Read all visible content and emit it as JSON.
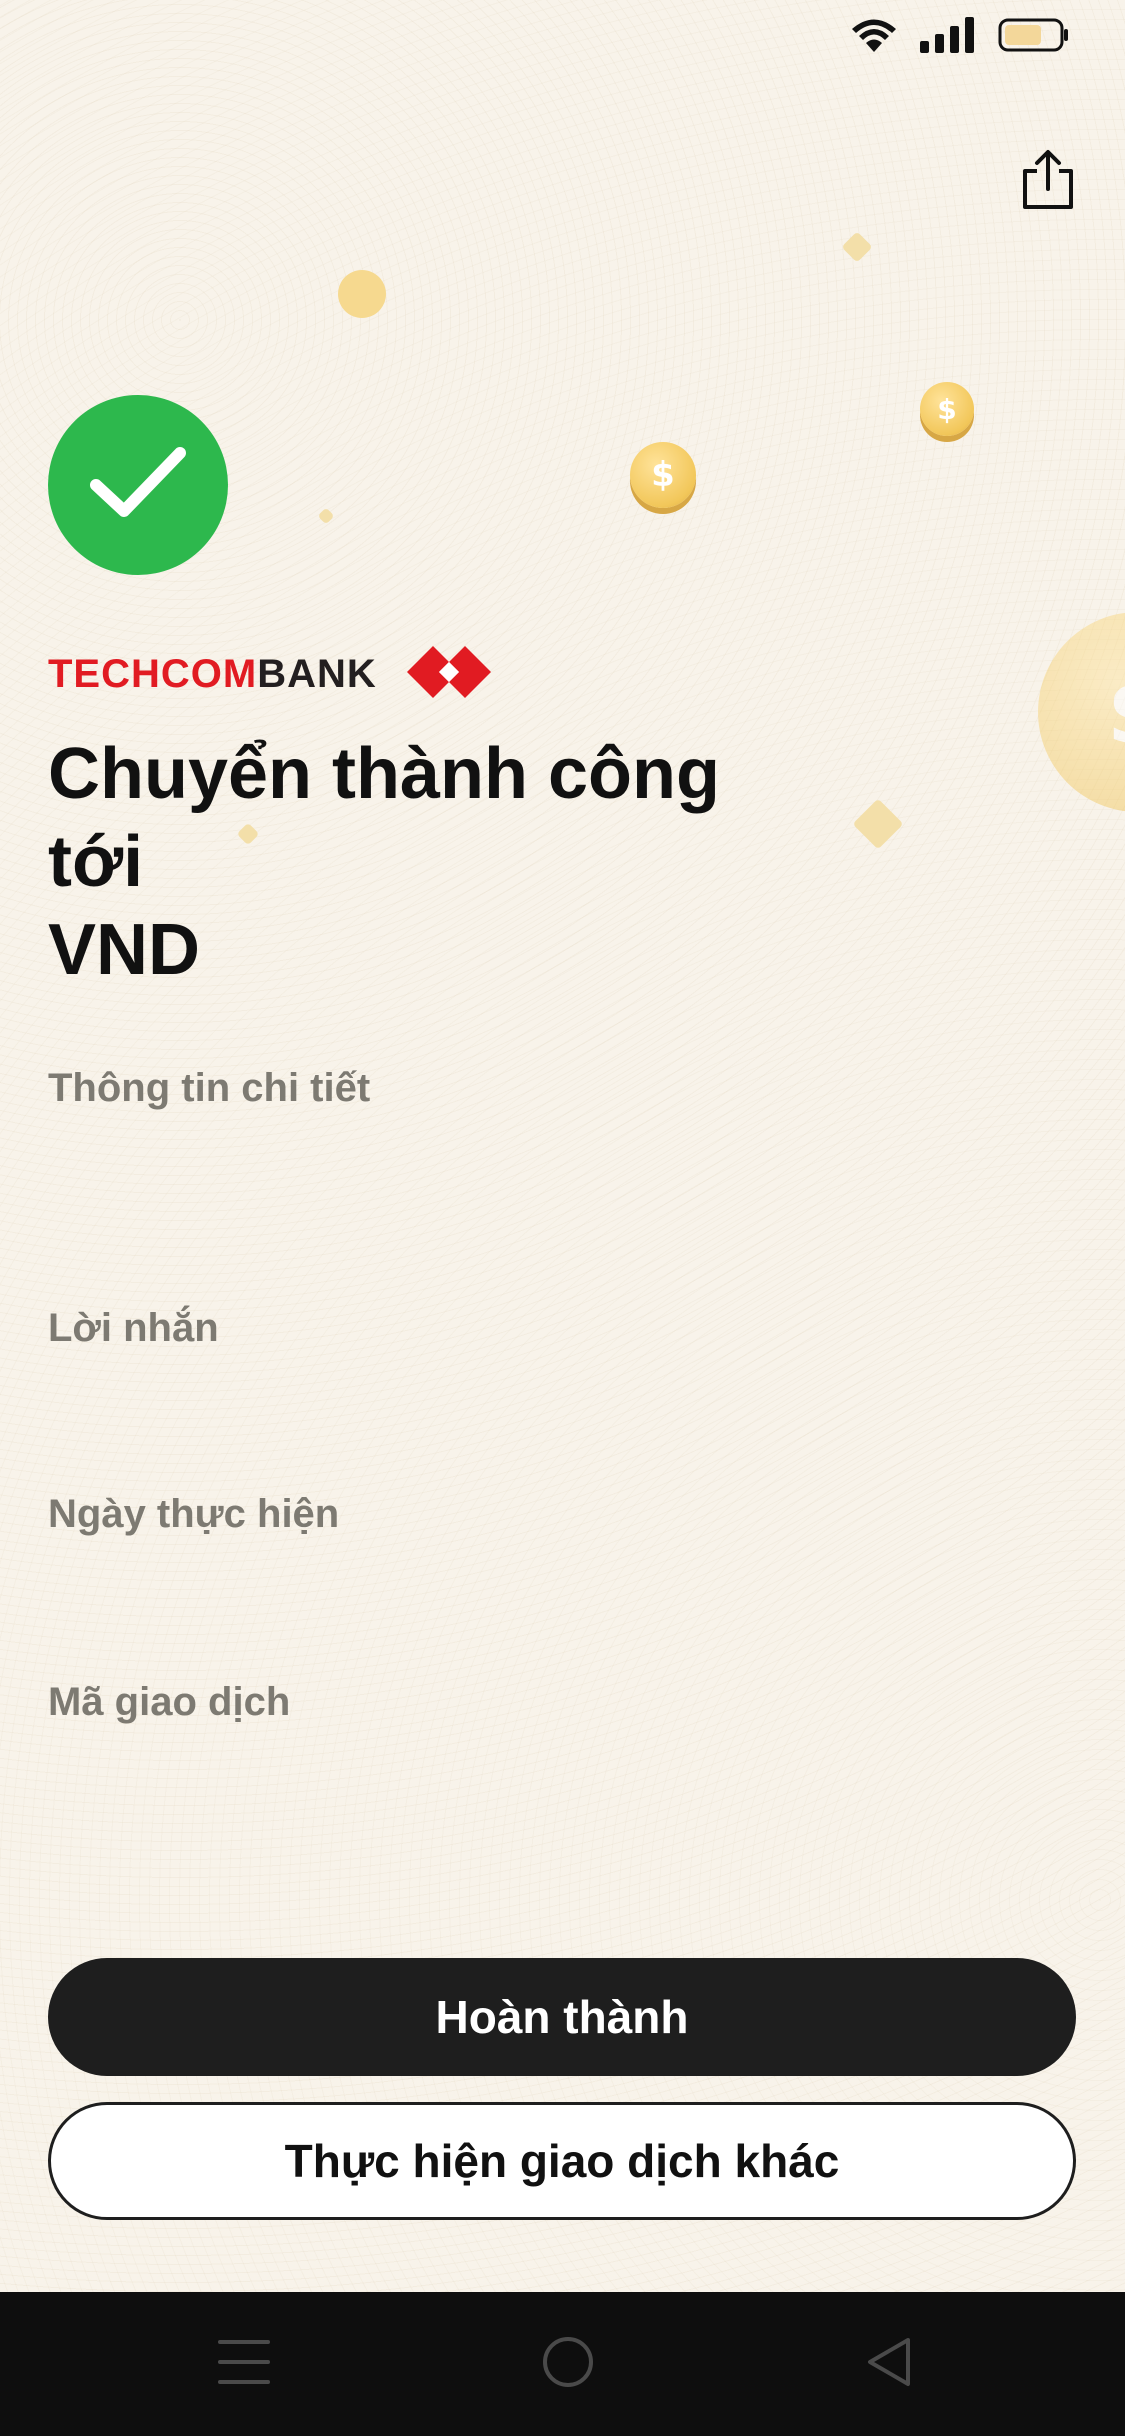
{
  "brand": {
    "name_part1": "TECHCOM",
    "name_part2": "BANK",
    "red": "#e11b22",
    "dark": "#231f20"
  },
  "title": {
    "line1": "Chuyển thành công",
    "line2": "tới",
    "line3": "VND"
  },
  "details": {
    "section_label": "Thông tin chi tiết",
    "message_label": "Lời nhắn",
    "date_label": "Ngày thực hiện",
    "transaction_id_label": "Mã giao dịch"
  },
  "buttons": {
    "done_label": "Hoàn thành",
    "another_label": "Thực hiện giao dịch khác"
  },
  "coins": {
    "symbol": "$"
  },
  "icons": {
    "status": [
      "wifi-icon",
      "signal-icon",
      "battery-icon"
    ],
    "share": "share-icon",
    "success": "checkmark-icon",
    "nav": [
      "menu-icon",
      "home-icon",
      "back-icon"
    ]
  },
  "colors": {
    "success_green": "#2db84d",
    "primary_button": "#1e1e1e",
    "background": "#f8f3ea",
    "label_gray": "#7d7a72"
  }
}
